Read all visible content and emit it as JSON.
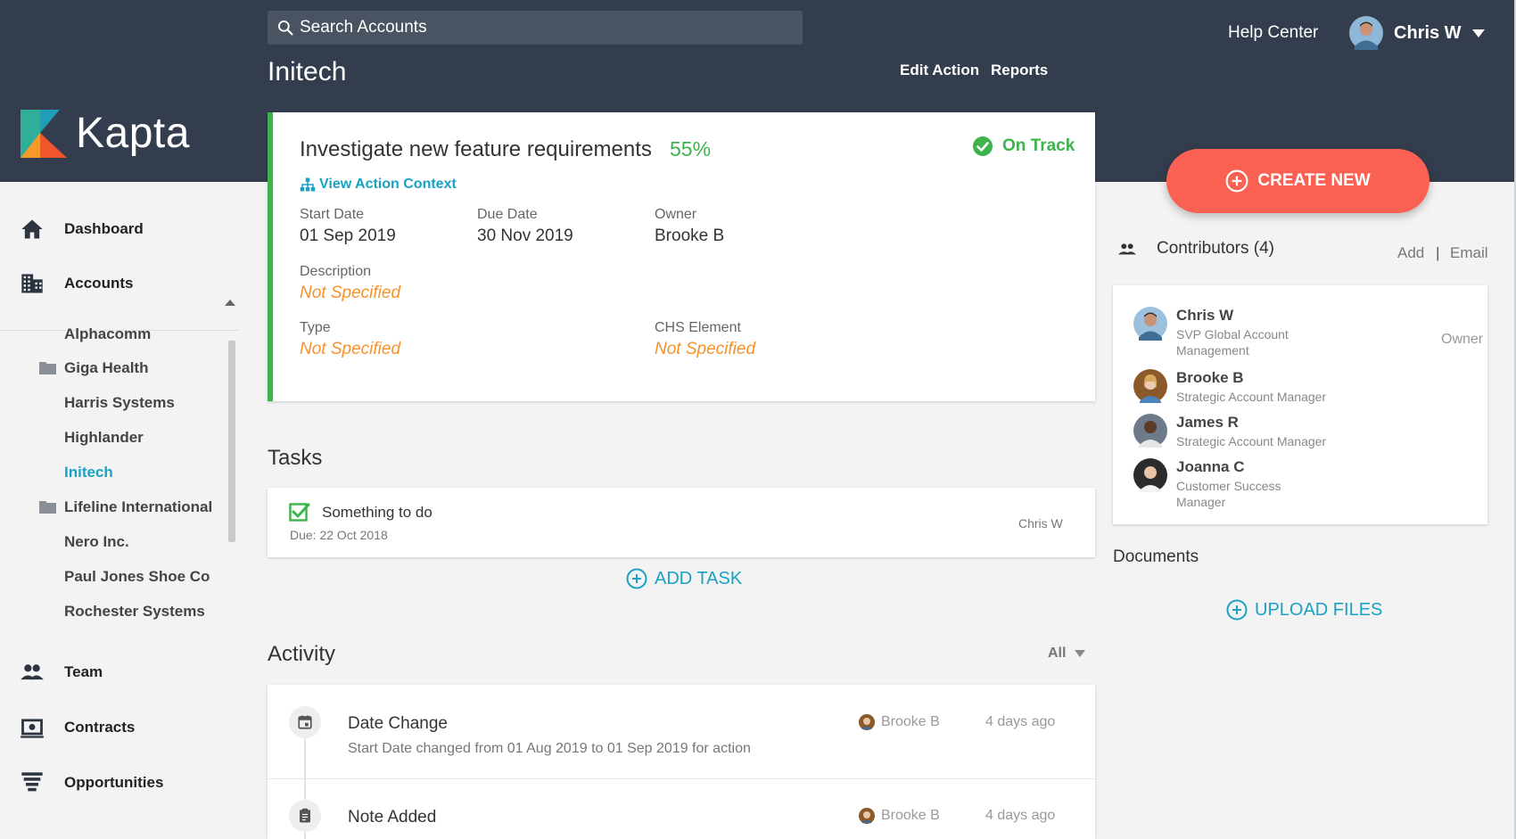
{
  "brand": {
    "name": "Kapta"
  },
  "search": {
    "placeholder": "Search Accounts"
  },
  "header": {
    "page_title": "Initech",
    "edit_action": "Edit Action",
    "reports": "Reports",
    "help_center": "Help Center",
    "user_name": "Chris W"
  },
  "sidebar": {
    "nav": [
      {
        "label": "Dashboard",
        "icon": "home-icon"
      },
      {
        "label": "Accounts",
        "icon": "building-icon"
      },
      {
        "label": "Team",
        "icon": "people-icon"
      },
      {
        "label": "Contracts",
        "icon": "contract-icon"
      },
      {
        "label": "Opportunities",
        "icon": "funnel-icon"
      }
    ],
    "accounts": [
      {
        "label": "Alphacomm",
        "folder": false
      },
      {
        "label": "Giga Health",
        "folder": true
      },
      {
        "label": "Harris Systems",
        "folder": false
      },
      {
        "label": "Highlander",
        "folder": false
      },
      {
        "label": "Initech",
        "folder": false,
        "active": true
      },
      {
        "label": "Lifeline International",
        "folder": true
      },
      {
        "label": "Nero Inc.",
        "folder": false
      },
      {
        "label": "Paul Jones Shoe Co",
        "folder": false
      },
      {
        "label": "Rochester Systems",
        "folder": false
      }
    ]
  },
  "action": {
    "title": "Investigate new feature requirements",
    "progress": "55%",
    "status": "On Track",
    "context_link": "View Action Context",
    "start_date_label": "Start Date",
    "start_date": "01 Sep 2019",
    "due_date_label": "Due Date",
    "due_date": "30 Nov 2019",
    "owner_label": "Owner",
    "owner": "Brooke B",
    "description_label": "Description",
    "description": "Not Specified",
    "type_label": "Type",
    "type": "Not Specified",
    "chs_label": "CHS Element",
    "chs": "Not Specified"
  },
  "tasks": {
    "heading": "Tasks",
    "items": [
      {
        "name": "Something to do",
        "due": "Due: 22 Oct 2018",
        "owner": "Chris W",
        "done": true
      }
    ],
    "add_label": "ADD TASK"
  },
  "activity": {
    "heading": "Activity",
    "filter": "All",
    "items": [
      {
        "title": "Date Change",
        "desc": "Start Date changed from 01 Aug 2019 to 01 Sep 2019 for action",
        "user": "Brooke B",
        "time": "4 days ago",
        "icon": "calendar-icon"
      },
      {
        "title": "Note Added",
        "desc": "",
        "user": "Brooke B",
        "time": "4 days ago",
        "icon": "clipboard-icon"
      }
    ]
  },
  "create_new": "CREATE NEW",
  "contributors": {
    "heading": "Contributors (4)",
    "add": "Add",
    "separator": "|",
    "email": "Email",
    "people": [
      {
        "name": "Chris W",
        "role": "SVP Global Account Management",
        "tag": "Owner"
      },
      {
        "name": "Brooke B",
        "role": "Strategic Account Manager",
        "tag": ""
      },
      {
        "name": "James R",
        "role": "Strategic Account Manager",
        "tag": ""
      },
      {
        "name": "Joanna C",
        "role": "Customer Success Manager",
        "tag": ""
      }
    ]
  },
  "documents": {
    "heading": "Documents",
    "upload": "UPLOAD FILES"
  },
  "colors": {
    "header_bg": "#333d4d",
    "accent": "#19a2c4",
    "success": "#3db34c",
    "warning": "#f7922a",
    "create": "#fa6152"
  }
}
